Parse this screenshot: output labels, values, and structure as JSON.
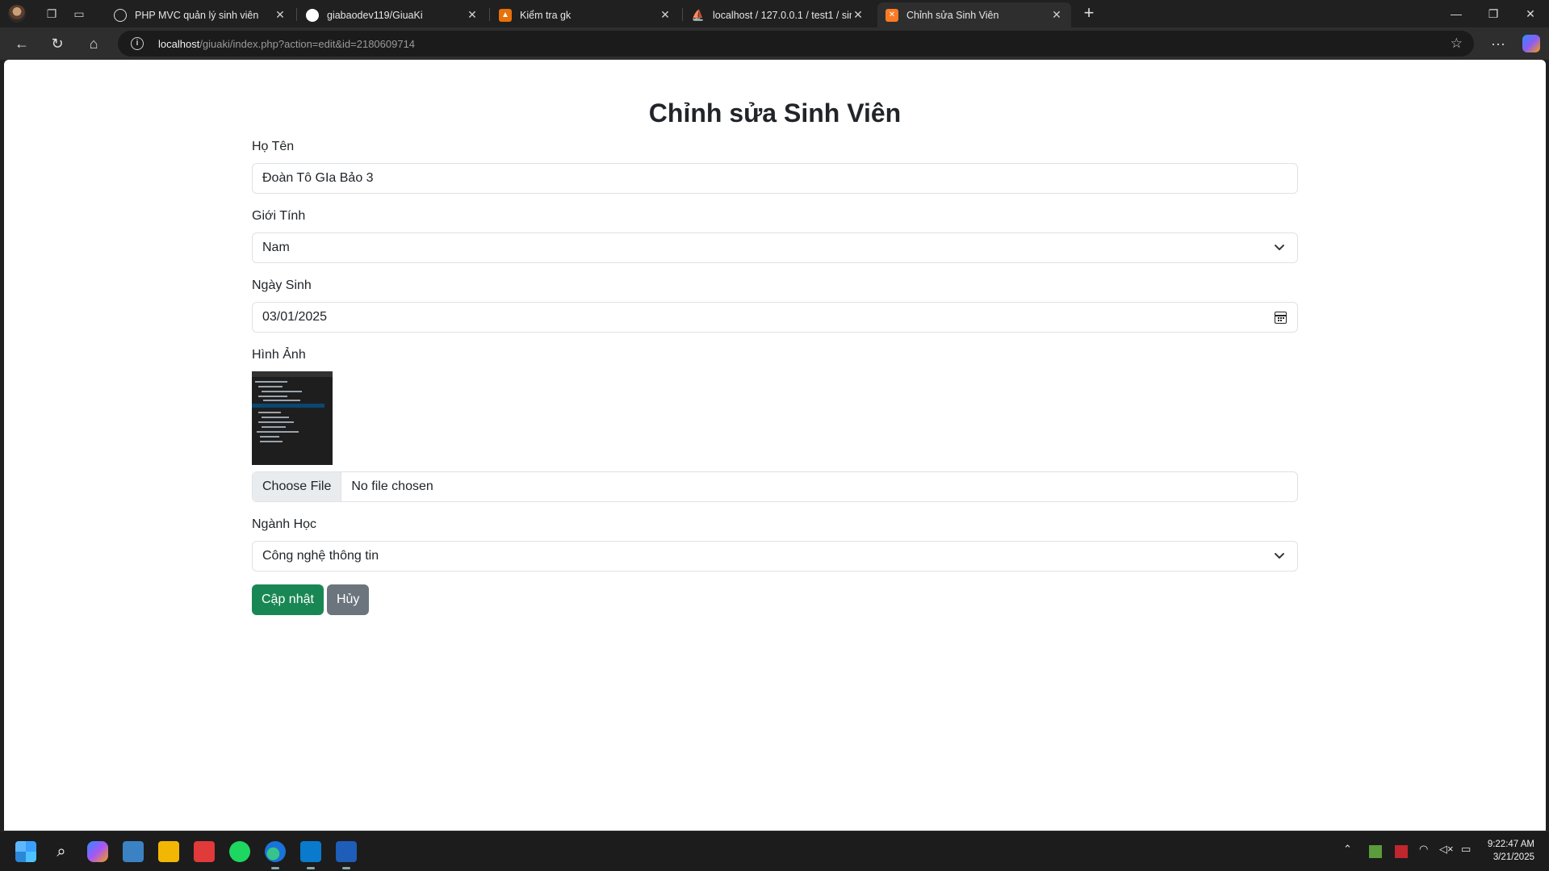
{
  "browser": {
    "tabs": [
      {
        "title": "PHP MVC quản lý sinh viên",
        "favicon": "chatgpt-icon",
        "active": false
      },
      {
        "title": "giabaodev119/GiuaKi",
        "favicon": "github-icon",
        "active": false
      },
      {
        "title": "Kiểm tra gk",
        "favicon": "classroom-icon",
        "active": false
      },
      {
        "title": "localhost / 127.0.0.1 / test1 / sinh",
        "favicon": "phpmyadmin-icon",
        "active": false
      },
      {
        "title": "Chỉnh sửa Sinh Viên",
        "favicon": "xampp-icon",
        "active": true
      }
    ],
    "url_host": "localhost",
    "url_path": "/giuaki/index.php?action=edit&id=2180609714"
  },
  "page": {
    "title": "Chỉnh sửa Sinh Viên",
    "fields": {
      "ho_ten": {
        "label": "Họ Tên",
        "value": "Đoàn Tô GIa Bảo 3"
      },
      "gioi_tinh": {
        "label": "Giới Tính",
        "value": "Nam"
      },
      "ngay_sinh": {
        "label": "Ngày Sinh",
        "value": "03/01/2025"
      },
      "hinh_anh": {
        "label": "Hình Ảnh",
        "choose_label": "Choose File",
        "no_file": "No file chosen"
      },
      "nganh_hoc": {
        "label": "Ngành Học",
        "value": "Công nghệ thông tin"
      }
    },
    "buttons": {
      "update": "Cập nhật",
      "cancel": "Hủy"
    }
  },
  "taskbar": {
    "time": "9:22:47 AM",
    "date": "3/21/2025"
  },
  "colors": {
    "primary": "#198754",
    "secondary": "#6c757d",
    "browser_bg": "#202020"
  }
}
